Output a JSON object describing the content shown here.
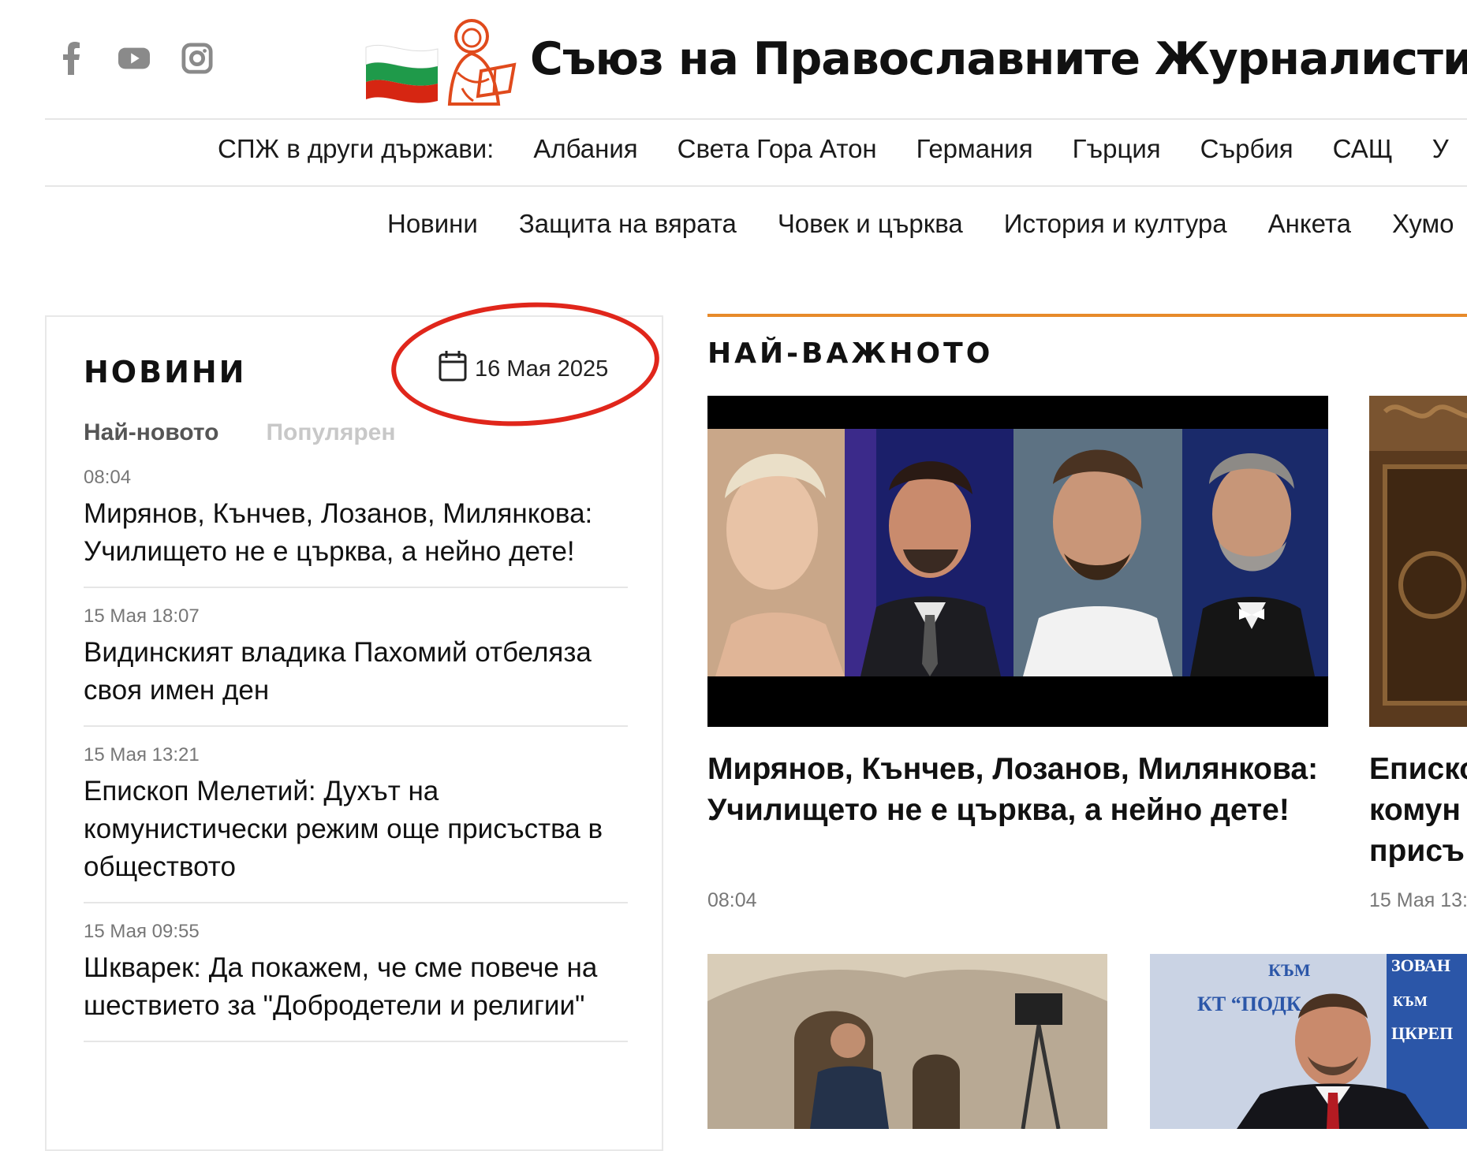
{
  "header": {
    "site_title": "Съюз на Православните Журналисти",
    "social": [
      {
        "icon": "facebook-icon"
      },
      {
        "icon": "youtube-icon"
      },
      {
        "icon": "instagram-icon"
      }
    ],
    "colors": {
      "flag_white": "#ffffff",
      "flag_green": "#1f9a4a",
      "flag_red": "#d62612",
      "logo_red": "#e04a1c"
    }
  },
  "nav_countries": {
    "label": "СПЖ в други държави:",
    "items": [
      "Албания",
      "Света Гора Атон",
      "Германия",
      "Гърция",
      "Сърбия",
      "САЩ",
      "У"
    ]
  },
  "nav_main": {
    "items": [
      "Новини",
      "Защита на вярата",
      "Човек и църква",
      "История и култура",
      "Анкета",
      "Хумо"
    ]
  },
  "news_panel": {
    "title": "НОВИНИ",
    "date": "16 Мая 2025",
    "tabs": [
      "Най-новото",
      "Популярен"
    ],
    "items": [
      {
        "time": "08:04",
        "headline": "Мирянов, Кънчев, Лозанов, Милянкова: Училището не е църква, а нейно дете!"
      },
      {
        "time": "15 Мая 18:07",
        "headline": "Видинският владика Пахомий отбеляза своя имен ден"
      },
      {
        "time": "15 Мая 13:21",
        "headline": "Епископ Мелетий: Духът на комунистически режим още присъства в обществото"
      },
      {
        "time": "15 Мая 09:55",
        "headline": "Шкварек: Да покажем, че сме повече на шествието за \"Добродетели и религии\""
      }
    ]
  },
  "featured": {
    "section_title": "НАЙ-ВАЖНОТО",
    "accent_color": "#e78a2a",
    "main": {
      "headline": "Мирянов, Кънчев, Лозанов, Милянкова: Училището не е църква, а нейно дете!",
      "time": "08:04"
    },
    "side": {
      "headline_lines": [
        "Еписко",
        "комун",
        "присъ"
      ],
      "time": "15 Мая 13:"
    },
    "thumb_texts": {
      "banner_left": "КЪМ",
      "banner_left2": "КТ “ПОДК",
      "banner_right1": "ЗОВАН",
      "banner_right2": "КЪМ",
      "banner_right3": "ЦКРЕП"
    }
  }
}
